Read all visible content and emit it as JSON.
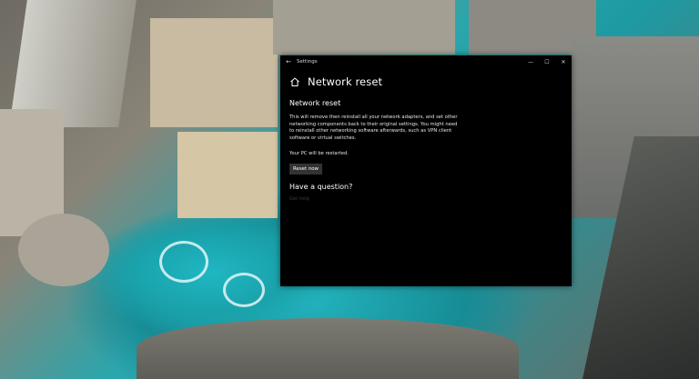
{
  "window": {
    "title": "Settings",
    "back_icon": "←",
    "controls": {
      "minimize": "—",
      "maximize": "☐",
      "close": "✕"
    }
  },
  "page": {
    "home_icon": "home-icon",
    "title": "Network reset"
  },
  "section": {
    "title": "Network reset",
    "description": "This will remove then reinstall all your network adapters, and set other networking components back to their original settings. You might need to reinstall other networking software afterwards, such as VPN client software or virtual switches.",
    "restart_note": "Your PC will be restarted.",
    "reset_button": "Reset now"
  },
  "help": {
    "title": "Have a question?",
    "link": "Get help"
  },
  "colors": {
    "window_bg": "#000000",
    "button_bg": "#333333",
    "wallpaper_water": "#1fb7c3"
  }
}
